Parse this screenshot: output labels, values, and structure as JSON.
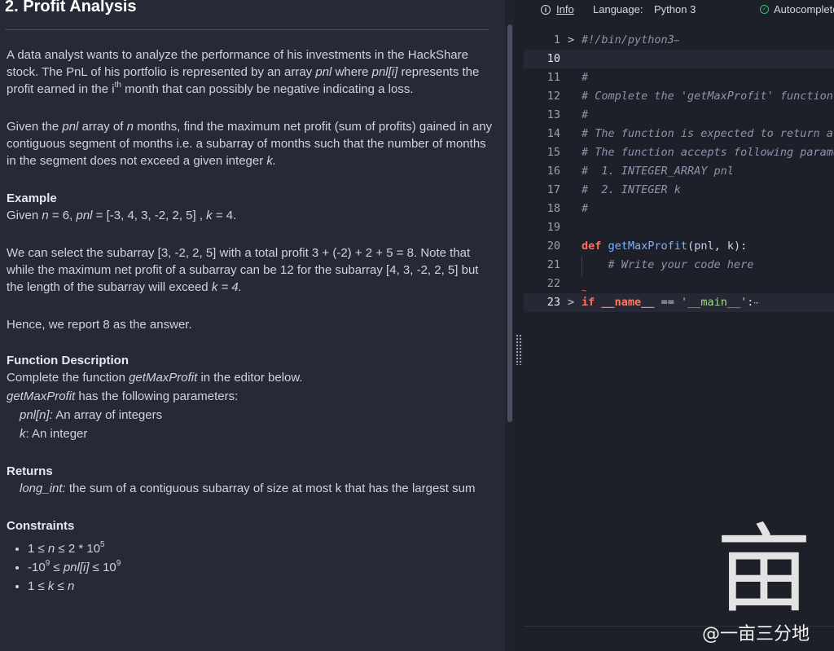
{
  "problem": {
    "title": "2. Profit Analysis",
    "intro_1": "A data analyst wants to analyze the performance of his investments in the HackShare stock. The PnL of his portfolio is represented by an array ",
    "intro_pnl": "pnl",
    "intro_2": " where ",
    "intro_pnl_i": "pnl[i]",
    "intro_3": " represents the profit earned in the i",
    "intro_sup": "th",
    "intro_4": " month that can possibly be negative indicating a loss.",
    "given_1": "Given the ",
    "given_pnl": "pnl",
    "given_2": " array of ",
    "given_n": "n",
    "given_3": " months, find the maximum net profit (sum of profits) gained in any contiguous segment of months i.e. a subarray of months such that the number of months in the segment does not exceed a given integer ",
    "given_k": "k.",
    "example_heading": "Example",
    "example_1": "Given ",
    "example_n": "n",
    "example_2": " = 6, ",
    "example_pnl": "pnl",
    "example_3": " = [-3, 4, 3, -2, 2, 5] , ",
    "example_k": "k",
    "example_4": " = 4.",
    "select_1": "We can select the subarray [3, -2, 2, 5] with a total profit 3 + (-2) + 2 + 5 = 8. Note that while the maximum net profit of a subarray can be 12 for the subarray [4, 3, -2, 2, 5] but the length of the subarray will exceed ",
    "select_k": "k = 4.",
    "hence": "Hence, we report 8 as the answer.",
    "function_heading": "Function Description",
    "function_1": "Complete the function ",
    "function_name": "getMaxProfit",
    "function_2": " in the editor below.",
    "params_name": "getMaxProfit",
    "params_text": " has the following parameters:",
    "param1_name": "pnl[n]:",
    "param1_desc": "  An array of integers",
    "param2_name": "k",
    "param2_desc": ": An integer",
    "returns_heading": "Returns",
    "returns_type": "long_int:",
    "returns_desc": " the sum of a contiguous subarray of size at most k that has the largest sum",
    "constraints_heading": "Constraints",
    "c1_a": "1 ≤ ",
    "c1_n": "n",
    "c1_b": " ≤ 2 * 10",
    "c1_sup": "5",
    "c2_a": "-10",
    "c2_sup1": "9",
    "c2_b": " ≤ ",
    "c2_pnl": "pnl[i]",
    "c2_c": " ≤ 10",
    "c2_sup2": "9",
    "c3_a": "1 ≤ ",
    "c3_k": "k",
    "c3_b": " ≤ ",
    "c3_n": "n"
  },
  "editor_header": {
    "info_icon": "i",
    "info_label": "Info",
    "language_label": "Language:",
    "language_value": "Python 3",
    "autocomplete_icon": "✓",
    "autocomplete_label": "Autocomplete"
  },
  "code": {
    "l1_num": "1",
    "l1_fold": ">",
    "l1_text": "#!/bin/python3",
    "l1_ellipsis": "⋯",
    "l10_num": "10",
    "l11_num": "11",
    "l11_text": "#",
    "l12_num": "12",
    "l12_text": "# Complete the 'getMaxProfit' function below.",
    "l13_num": "13",
    "l13_text": "#",
    "l14_num": "14",
    "l14_text": "# The function is expected to return a LONG_INTEGER.",
    "l15_num": "15",
    "l15_text": "# The function accepts following parameters:",
    "l16_num": "16",
    "l16_text": "#  1. INTEGER_ARRAY pnl",
    "l17_num": "17",
    "l17_text": "#  2. INTEGER k",
    "l18_num": "18",
    "l18_text": "#",
    "l19_num": "19",
    "l20_num": "20",
    "l20_def": "def",
    "l20_fn": "getMaxProfit",
    "l20_open": "(",
    "l20_p1": "pnl",
    "l20_comma": ", ",
    "l20_p2": "k",
    "l20_close": "):",
    "l21_num": "21",
    "l21_text": "    # Write your code here",
    "l22_num": "22",
    "l23_num": "23",
    "l23_fold": ">",
    "l23_if": "if",
    "l23_name": "__name__",
    "l23_eq": " == ",
    "l23_str": "'__main__'",
    "l23_colon": ":",
    "l23_ellipsis": "⋯"
  },
  "watermark": {
    "glyph": "亩",
    "text": "@一亩三分地"
  },
  "colors": {
    "background": "#262a37",
    "editor": "#1e2029",
    "keyword": "#ff6e5a",
    "function": "#7ab4ff",
    "string": "#a4d88a"
  }
}
